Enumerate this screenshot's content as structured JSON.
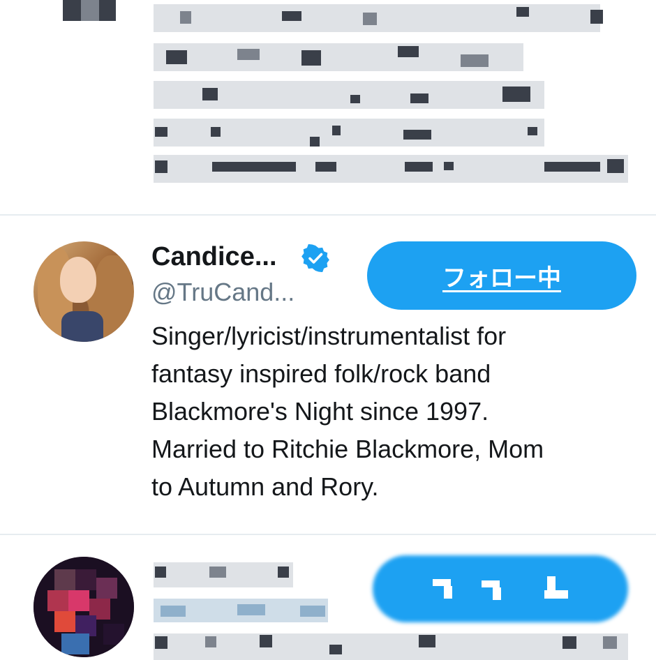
{
  "main_user": {
    "display_name": "Candice...",
    "handle": "@TruCand...",
    "verified": true,
    "verified_icon": "verified-badge-icon",
    "follow_button_label": "フォロー中",
    "bio_lines": [
      "Singer/lyricist/instrumentalist for",
      "fantasy inspired folk/rock band",
      "Blackmore's Night since 1997.",
      "Married to Ritchie Blackmore, Mom",
      "to Autumn and Rory."
    ]
  },
  "colors": {
    "accent": "#1da1f2",
    "text": "#14171a",
    "secondary": "#657786",
    "divider": "#e6ecf0"
  }
}
